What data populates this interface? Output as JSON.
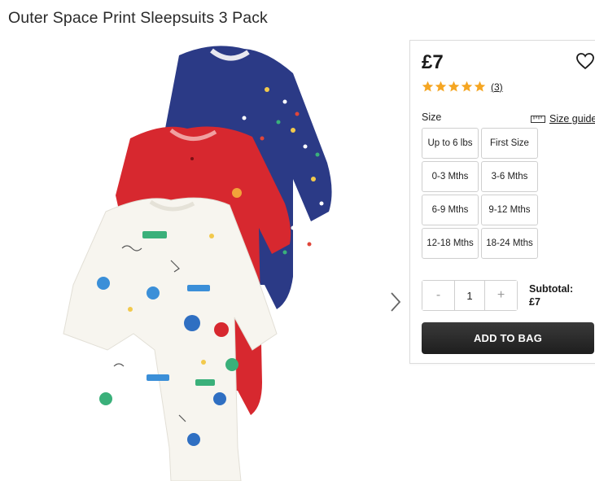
{
  "product": {
    "title": "Outer Space Print Sleepsuits 3 Pack",
    "price": "£7",
    "rating": {
      "stars": 5,
      "review_count": "(3)"
    }
  },
  "size": {
    "label": "Size",
    "guide_label": "Size guide",
    "options": [
      "Up to 6 lbs",
      "First Size",
      "0-3 Mths",
      "3-6 Mths",
      "6-9 Mths",
      "9-12 Mths",
      "12-18 Mths",
      "18-24 Mths"
    ]
  },
  "quantity": {
    "decrement": "-",
    "value": "1",
    "increment": "+"
  },
  "subtotal": {
    "label": "Subtotal:",
    "value": "£7"
  },
  "add_to_bag": "ADD TO BAG",
  "icons": {
    "wishlist": "heart-outline-icon",
    "next": "chevron-right-icon",
    "size_guide": "ruler-icon",
    "rating": "star-icon"
  },
  "colors": {
    "star": "#f5a623",
    "button": "#2b2b2b",
    "navy": "#2b3a86",
    "red": "#d7282f",
    "cream": "#f7f5ef"
  }
}
